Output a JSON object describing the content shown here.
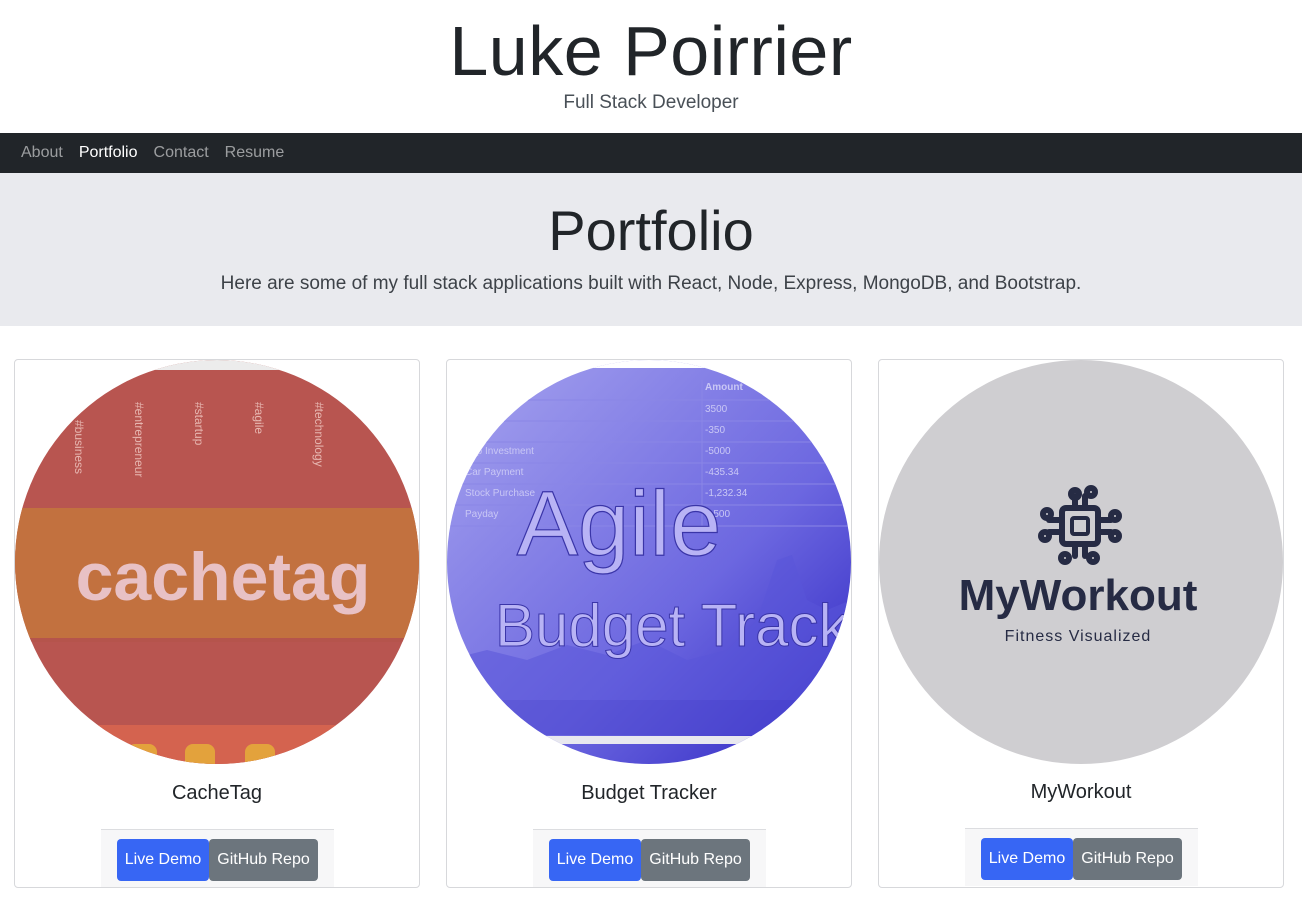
{
  "header": {
    "title": "Luke Poirrier",
    "subtitle": "Full Stack Developer"
  },
  "nav": {
    "items": [
      {
        "label": "About",
        "active": false
      },
      {
        "label": "Portfolio",
        "active": true
      },
      {
        "label": "Contact",
        "active": false
      },
      {
        "label": "Resume",
        "active": false
      }
    ]
  },
  "jumbotron": {
    "title": "Portfolio",
    "text": "Here are some of my full stack applications built with React, Node, Express, MongoDB, and Bootstrap."
  },
  "projects": [
    {
      "title": "CacheTag",
      "live_label": "Live Demo",
      "repo_label": "GitHub Repo",
      "image": {
        "logo_text": "cachetag",
        "hashtags": [
          "#business",
          "#entrepreneur",
          "#startup",
          "#agile",
          "#technology"
        ]
      }
    },
    {
      "title": "Budget Tracker",
      "live_label": "Live Demo",
      "repo_label": "GitHub Repo",
      "image": {
        "line1": "Agile",
        "line2": "Budget Tracke",
        "table_header": "Amount",
        "rows": [
          {
            "label": "",
            "value": "3500"
          },
          {
            "label": "",
            "value": "-350"
          },
          {
            "label": "rtup Investment",
            "value": "-5000"
          },
          {
            "label": "Car Payment",
            "value": "-435.34"
          },
          {
            "label": "Stock Purchase",
            "value": "-1,232.34"
          },
          {
            "label": "Payday",
            "value": "2,500"
          }
        ]
      }
    },
    {
      "title": "MyWorkout",
      "live_label": "Live Demo",
      "repo_label": "GitHub Repo",
      "image": {
        "logo_text": "MyWorkout",
        "tagline": "Fitness Visualized",
        "icon": "chip-circuit-icon"
      }
    }
  ],
  "colors": {
    "navbar": "#212529",
    "jumbotron": "#e9eaee",
    "primary": "#3766f4",
    "secondary": "#6c757d",
    "cachetag_bg": "#b85550",
    "budget_bg": "#6e6ae0",
    "myworkout_bg": "#cfced1",
    "myworkout_text": "#262b44"
  }
}
